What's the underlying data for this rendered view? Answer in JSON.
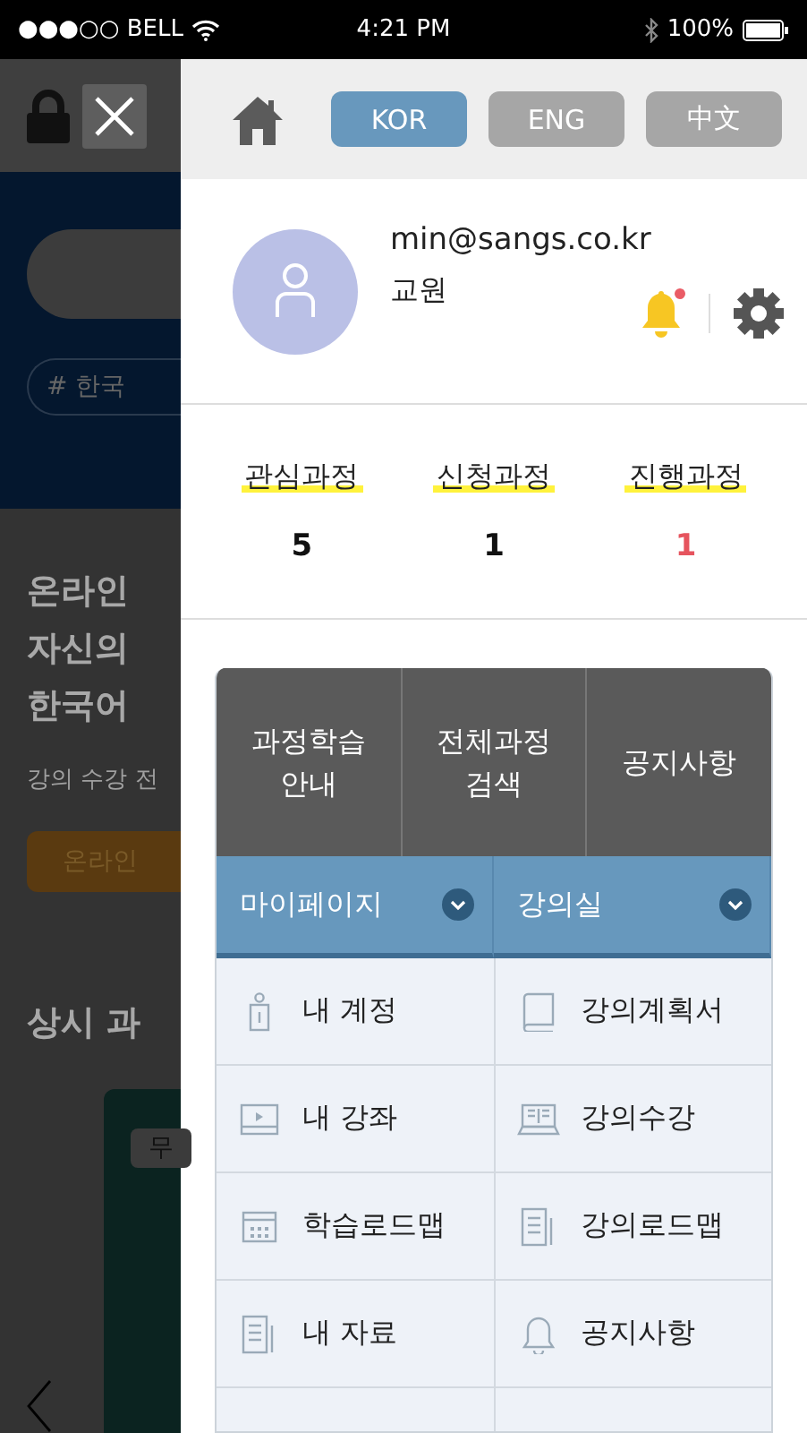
{
  "status_bar": {
    "carrier": "●●●○○ BELL",
    "time": "4:21 PM",
    "battery": "100%"
  },
  "background_page": {
    "tag": "# 한국",
    "headline": [
      "온라인",
      "자신의",
      "한국어"
    ],
    "subtext": "강의 수강 전",
    "button": "온라인",
    "section_title": "상시 과",
    "card_badge": "무"
  },
  "drawer": {
    "languages": [
      {
        "label": "KOR",
        "selected": true
      },
      {
        "label": "ENG",
        "selected": false
      },
      {
        "label": "中文",
        "selected": false
      }
    ],
    "user": {
      "email": "min@sangs.co.kr",
      "role": "교원",
      "has_notification": true
    },
    "counts": [
      {
        "label": "관심과정",
        "value": "5",
        "highlight": false
      },
      {
        "label": "신청과정",
        "value": "1",
        "highlight": false
      },
      {
        "label": "진행과정",
        "value": "1",
        "highlight": true
      }
    ],
    "quick_links": [
      {
        "lines": [
          "과정학습",
          "안내"
        ]
      },
      {
        "lines": [
          "전체과정",
          "검색"
        ]
      },
      {
        "lines": [
          "공지사항"
        ]
      }
    ],
    "sections": [
      {
        "title": "마이페이지",
        "items": [
          {
            "label": "내 계정",
            "kind": "person"
          },
          {
            "label": "내 강좌",
            "kind": "video"
          },
          {
            "label": "학습로드맵",
            "kind": "calendar"
          },
          {
            "label": "내 자료",
            "kind": "document"
          }
        ]
      },
      {
        "title": "강의실",
        "items": [
          {
            "label": "강의계획서",
            "kind": "book"
          },
          {
            "label": "강의수강",
            "kind": "laptop"
          },
          {
            "label": "강의로드맵",
            "kind": "document"
          },
          {
            "label": "공지사항",
            "kind": "bell"
          }
        ]
      }
    ]
  }
}
